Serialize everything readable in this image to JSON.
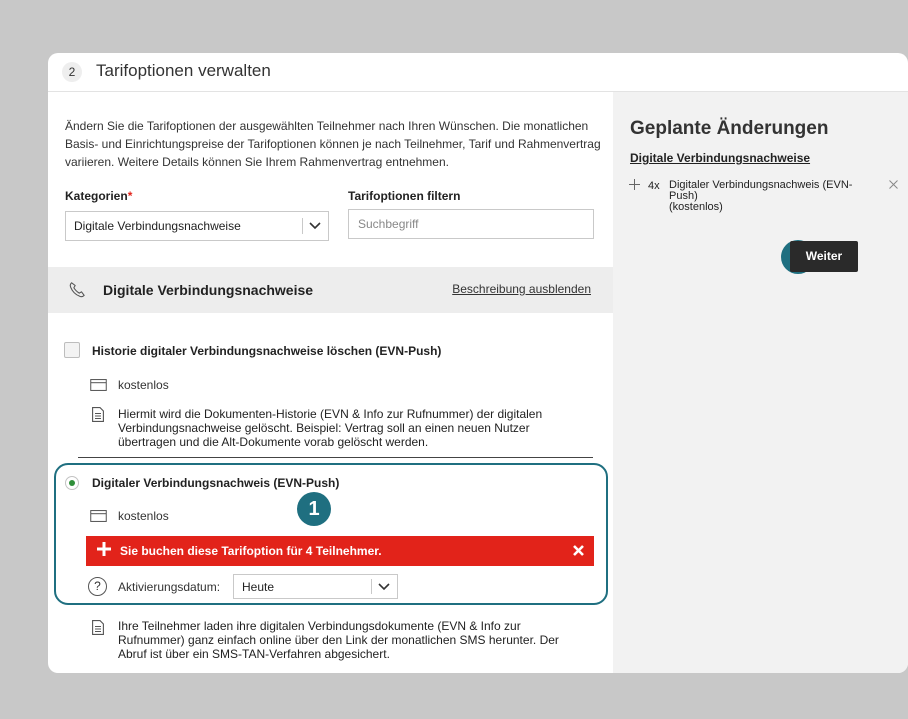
{
  "header": {
    "step": "2",
    "title": "Tarifoptionen verwalten"
  },
  "intro": "Ändern Sie die Tarifoptionen der ausgewählten Teilnehmer nach Ihren Wünschen. Die monatlichen Basis- und Einrichtungspreise der Tarifoptionen können je nach Teilnehmer, Tarif und Rahmenvertrag variieren. Weitere Details können Sie Ihrem Rahmenvertrag entnehmen.",
  "kategorien": {
    "label": "Kategorien",
    "required_mark": "*",
    "value": "Digitale Verbindungsnachweise"
  },
  "filter": {
    "label": "Tarifoptionen filtern",
    "placeholder": "Suchbegriff"
  },
  "section": {
    "title": "Digitale Verbindungsnachweise",
    "toggle_link": "Beschreibung ausblenden",
    "icon": "phone-icon"
  },
  "option1": {
    "title": "Historie digitaler Verbindungsnachweise löschen (EVN-Push)",
    "price": "kostenlos",
    "description": "Hiermit wird die Dokumenten-Historie (EVN & Info zur Rufnummer) der digitalen Verbindungsnachweise gelöscht. Beispiel: Vertrag soll an einen neuen Nutzer übertragen und die Alt-Dokumente vorab gelöscht werden.",
    "checked": false
  },
  "option2": {
    "title": "Digitaler Verbindungsnachweis (EVN-Push)",
    "price": "kostenlos",
    "selected": true,
    "alert": "Sie buchen diese Tarifoption für 4 Teilnehmer.",
    "activation_label": "Aktivierungsdatum:",
    "activation_value": "Heute",
    "help_glyph": "?",
    "description": "Ihre Teilnehmer laden ihre digitalen Verbindungsdokumente (EVN & Info zur Rufnummer) ganz einfach online über den Link der monatlichen SMS herunter. Der Abruf ist über ein SMS-TAN-Verfahren abgesichert."
  },
  "badges": {
    "one": "1",
    "two": "2"
  },
  "planned": {
    "title": "Geplante Änderungen",
    "category": "Digitale Verbindungsnachweise",
    "items": [
      {
        "count": "4x",
        "name": "Digitaler Verbindungsnachweis (EVN-Push)",
        "price": "(kostenlos)"
      }
    ]
  },
  "weiter_button": "Weiter",
  "colors": {
    "accent": "#1f6f80",
    "alert": "#e2231a",
    "button": "#2a2a2a",
    "radio": "#2f8f3a"
  }
}
